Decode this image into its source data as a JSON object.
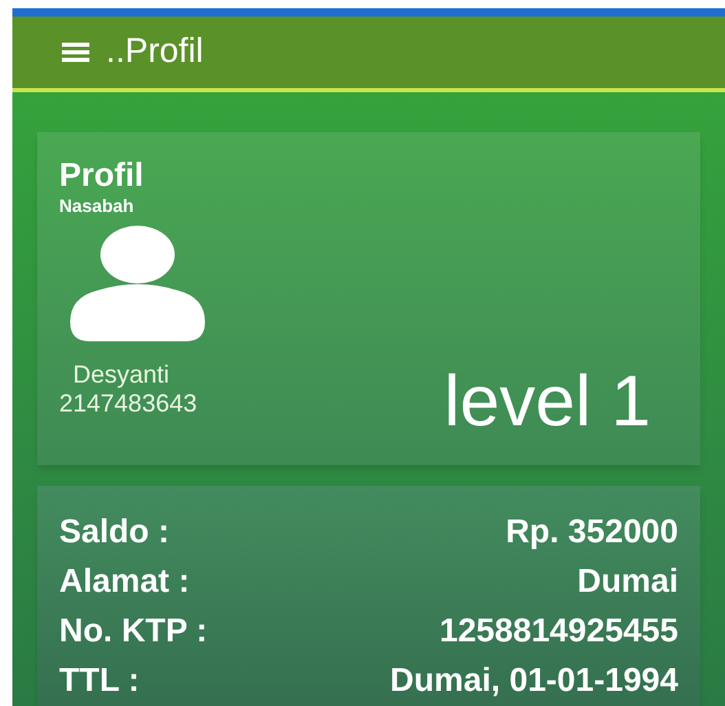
{
  "header": {
    "title": "..Profil"
  },
  "profile_card": {
    "title": "Profil",
    "subtitle": "Nasabah",
    "name": "Desyanti",
    "number": "2147483643",
    "level": "level 1"
  },
  "details": [
    {
      "label": "Saldo :",
      "value": "Rp. 352000"
    },
    {
      "label": "Alamat :",
      "value": "Dumai"
    },
    {
      "label": "No. KTP :",
      "value": "1258814925455"
    },
    {
      "label": "TTL :",
      "value": "Dumai, 01-01-1994"
    }
  ]
}
